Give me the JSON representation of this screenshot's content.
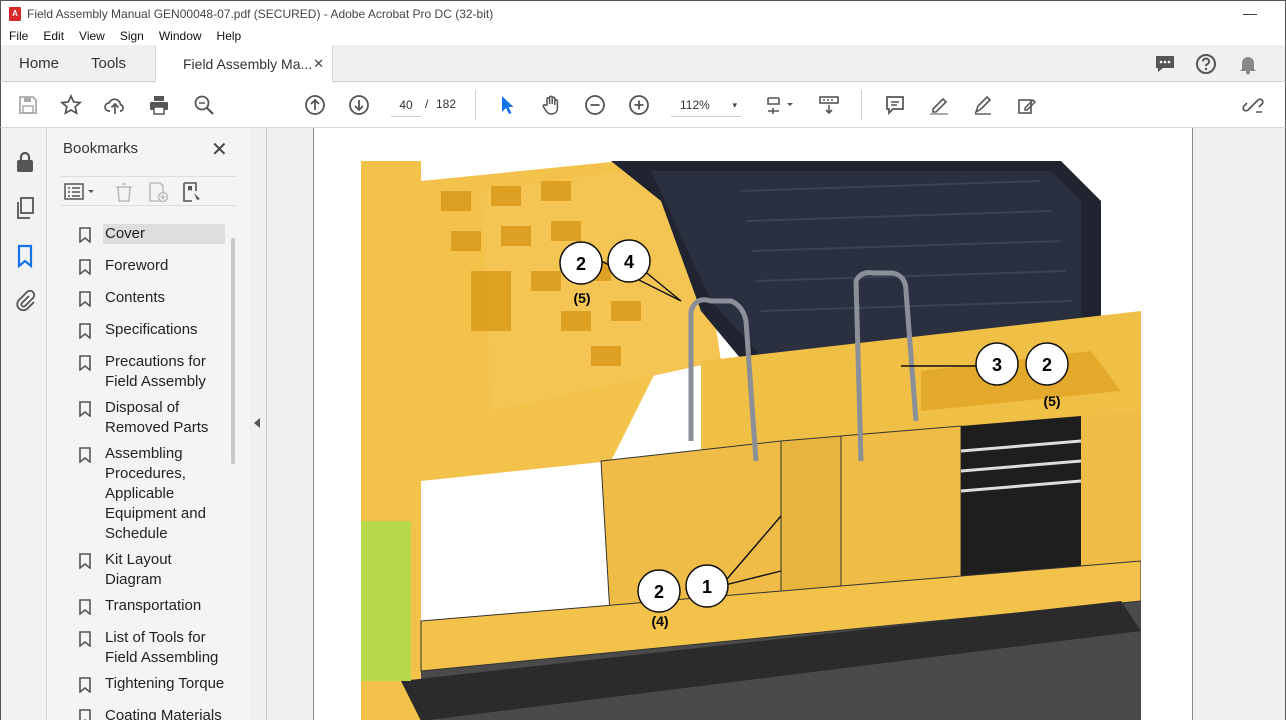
{
  "window": {
    "title": "Field Assembly Manual GEN00048-07.pdf (SECURED) - Adobe Acrobat Pro DC (32-bit)",
    "minimize_glyph": "—"
  },
  "menu": [
    "File",
    "Edit",
    "View",
    "Sign",
    "Window",
    "Help"
  ],
  "tabs": {
    "home": "Home",
    "tools": "Tools",
    "document": "Field Assembly Ma...",
    "close_glyph": "✕"
  },
  "toolbar": {
    "page_current": "40",
    "page_separator": "/",
    "page_total": "182",
    "zoom": "112%",
    "zoom_caret": "▾"
  },
  "bookmarks": {
    "header": "Bookmarks",
    "close_glyph": "✕",
    "items": [
      {
        "label": "Cover"
      },
      {
        "label": "Foreword"
      },
      {
        "label": "Contents"
      },
      {
        "label": "Specifications"
      },
      {
        "label": "Precautions for Field Assembly"
      },
      {
        "label": "Disposal of Removed Parts"
      },
      {
        "label": "Assembling Procedures, Applicable Equipment and Schedule"
      },
      {
        "label": "Kit Layout Diagram"
      },
      {
        "label": "Transportation"
      },
      {
        "label": "List of Tools for Field Assembling"
      },
      {
        "label": "Tightening Torque"
      },
      {
        "label": "Coating Materials"
      }
    ]
  },
  "figure": {
    "callouts": [
      {
        "n": "2",
        "sub": "(5)"
      },
      {
        "n": "4",
        "sub": ""
      },
      {
        "n": "3",
        "sub": ""
      },
      {
        "n": "2",
        "sub": "(5)"
      },
      {
        "n": "2",
        "sub": "(4)"
      },
      {
        "n": "1",
        "sub": ""
      }
    ]
  },
  "colors": {
    "accent": "#1473e6",
    "machine_yellow": "#f2c24b",
    "machine_dark": "#1f2430"
  }
}
